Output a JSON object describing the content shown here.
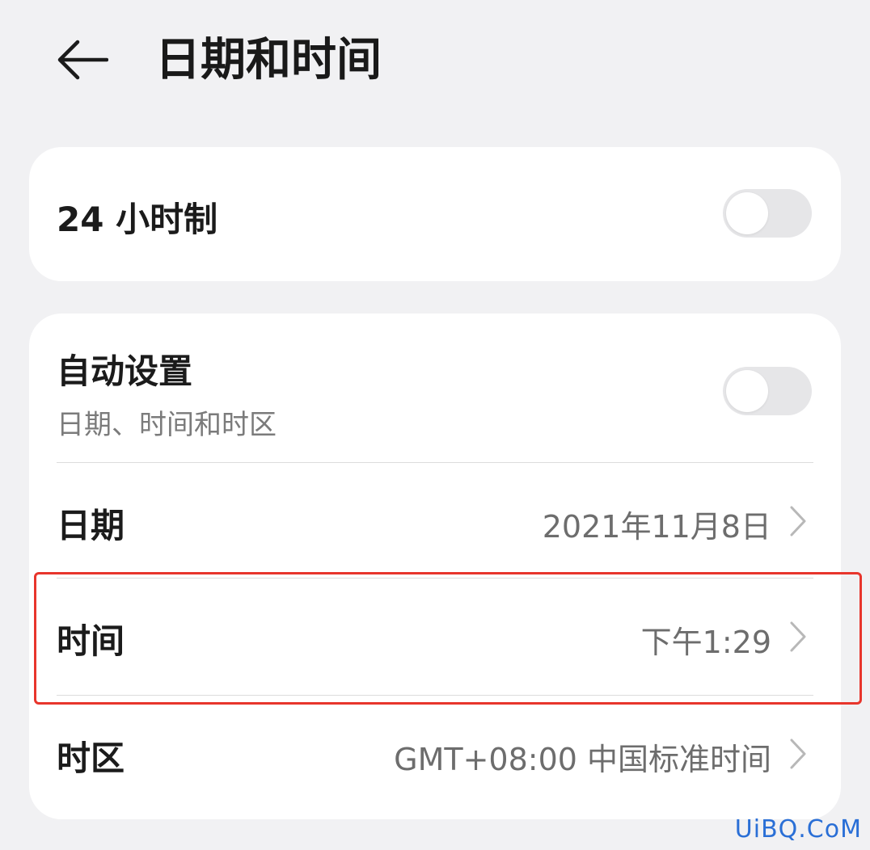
{
  "header": {
    "back_icon": "arrow-left-icon",
    "title": "日期和时间"
  },
  "format_card": {
    "hour24": {
      "label": "24 小时制",
      "enabled": false
    }
  },
  "settings_card": {
    "auto": {
      "label": "自动设置",
      "subtitle": "日期、时间和时区",
      "enabled": false
    },
    "date": {
      "label": "日期",
      "value": "2021年11月8日"
    },
    "time": {
      "label": "时间",
      "value": "下午1:29"
    },
    "timezone": {
      "label": "时区",
      "value": "GMT+08:00 中国标准时间"
    }
  },
  "watermark": "UiBQ.CoM",
  "colors": {
    "background": "#f1f1f3",
    "card": "#ffffff",
    "toggle_off": "#e6e6e8",
    "highlight": "#e8352c",
    "watermark": "#2a6fd6"
  }
}
